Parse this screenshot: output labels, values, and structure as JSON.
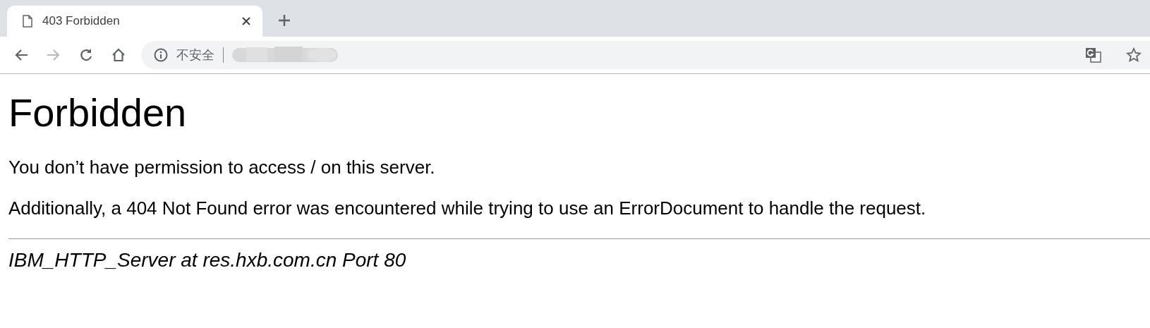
{
  "tabs": [
    {
      "title": "403 Forbidden",
      "selected": true
    }
  ],
  "toolbar": {
    "back": {
      "disabled": false
    },
    "forward": {
      "disabled": true
    }
  },
  "address_bar": {
    "security_label": "不安全"
  },
  "page": {
    "heading": "Forbidden",
    "paragraphs": [
      "You don’t have permission to access / on this server.",
      "Additionally, a 404 Not Found error was encountered while trying to use an ErrorDocument to handle the request."
    ],
    "address": "IBM_HTTP_Server at res.hxb.com.cn Port 80"
  }
}
